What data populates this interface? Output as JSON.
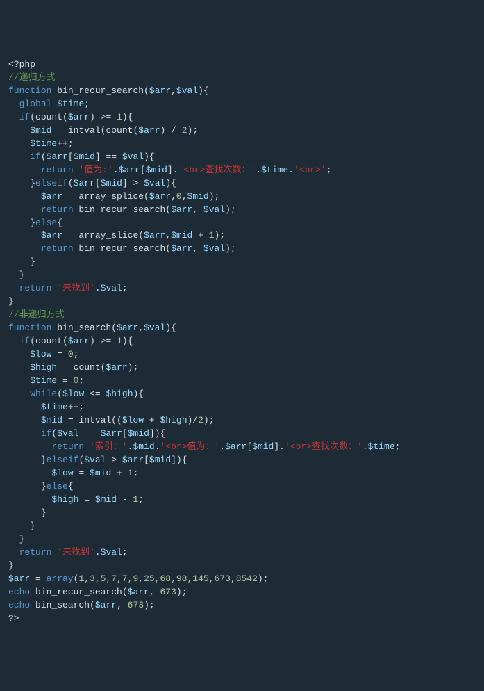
{
  "code": {
    "l1_tag_open": "<?php",
    "l2_cmt": "//递归方式",
    "l3_kw_function": "function",
    "l3_fn": " bin_recur_search(",
    "l3_vA": "$arr",
    "l3_c1": ",",
    "l3_vB": "$val",
    "l3_c2": "){",
    "l4_kw": "global",
    "l4_sp": " ",
    "l4_v": "$time",
    "l4_e": ";",
    "l5_kw": "if",
    "l5_o": "(count(",
    "l5_v": "$arr",
    "l5_c": ") >= ",
    "l5_n": "1",
    "l5_e": "){",
    "l6_v1": "$mid",
    "l6_eq": " = intval(count(",
    "l6_v2": "$arr",
    "l6_c": ") / ",
    "l6_n": "2",
    "l6_e": ");",
    "l7_v": "$time",
    "l7_e": "++;",
    "l8_kw": "if",
    "l8_o": "(",
    "l8_v1": "$arr",
    "l8_m1": "[",
    "l8_v2": "$mid",
    "l8_m2": "] == ",
    "l8_v3": "$val",
    "l8_e": "){",
    "l9_kw": "return",
    "l9_sp": " ",
    "l9_s1": "'值为:'",
    "l9_d1": ".",
    "l9_v1": "$arr",
    "l9_b1": "[",
    "l9_v2": "$mid",
    "l9_b2": "].",
    "l9_s2": "'<br>查找次数：'",
    "l9_d2": ".",
    "l9_v3": "$time",
    "l9_d3": ".",
    "l9_s3": "'<br>'",
    "l9_e": ";",
    "l10_c": "}",
    "l10_kw": "elseif",
    "l10_o": "(",
    "l10_v1": "$arr",
    "l10_b1": "[",
    "l10_v2": "$mid",
    "l10_b2": "] > ",
    "l10_v3": "$val",
    "l10_e": "){",
    "l11_v1": "$arr",
    "l11_eq": " = array_splice(",
    "l11_v2": "$arr",
    "l11_c1": ",",
    "l11_n1": "0",
    "l11_c2": ",",
    "l11_v3": "$mid",
    "l11_e": ");",
    "l12_kw": "return",
    "l12_sp": " bin_recur_search(",
    "l12_v1": "$arr",
    "l12_c": ", ",
    "l12_v2": "$val",
    "l12_e": ");",
    "l13_c": "}",
    "l13_kw": "else",
    "l13_e": "{",
    "l14_v1": "$arr",
    "l14_eq": " = array_slice(",
    "l14_v2": "$arr",
    "l14_c": ",",
    "l14_v3": "$mid",
    "l14_p": " + ",
    "l14_n": "1",
    "l14_e": ");",
    "l15_kw": "return",
    "l15_sp": " bin_recur_search(",
    "l15_v1": "$arr",
    "l15_c": ", ",
    "l15_v2": "$val",
    "l15_e": ");",
    "l16": "}",
    "l17": "}",
    "l18_kw": "return",
    "l18_sp": " ",
    "l18_s": "'未找到'",
    "l18_d": ".",
    "l18_v": "$val",
    "l18_e": ";",
    "l19": "}",
    "l20_cmt": "//非递归方式",
    "l21_kw": "function",
    "l21_fn": " bin_search(",
    "l21_v1": "$arr",
    "l21_c": ",",
    "l21_v2": "$val",
    "l21_e": "){",
    "l22_kw": "if",
    "l22_o": "(count(",
    "l22_v": "$arr",
    "l22_c": ") >= ",
    "l22_n": "1",
    "l22_e": "){",
    "l23_v": "$low",
    "l23_eq": " = ",
    "l23_n": "0",
    "l23_e": ";",
    "l24_v": "$high",
    "l24_eq": " = count(",
    "l24_v2": "$arr",
    "l24_e": ");",
    "l25_v": "$time",
    "l25_eq": " = ",
    "l25_n": "0",
    "l25_e": ";",
    "l26_kw": "while",
    "l26_o": "(",
    "l26_v1": "$low",
    "l26_c": " <= ",
    "l26_v2": "$high",
    "l26_e": "){",
    "l27_v": "$time",
    "l27_e": "++;",
    "l28_v1": "$mid",
    "l28_eq": " = intval((",
    "l28_v2": "$low",
    "l28_p": " + ",
    "l28_v3": "$high",
    "l28_c": ")/",
    "l28_n": "2",
    "l28_e": ");",
    "l29_kw": "if",
    "l29_o": "(",
    "l29_v1": "$val",
    "l29_c": " == ",
    "l29_v2": "$arr",
    "l29_b1": "[",
    "l29_v3": "$mid",
    "l29_b2": "]){",
    "l30_kw": "return",
    "l30_sp": " ",
    "l30_s1": "'索引：'",
    "l30_d1": ".",
    "l30_v1": "$mid",
    "l30_d2": ".",
    "l30_s2": "'<br>值为：'",
    "l30_d3": ".",
    "l30_v2": "$arr",
    "l30_b1": "[",
    "l30_v3": "$mid",
    "l30_b2": "].",
    "l30_s3": "'<br>查找次数：'",
    "l30_d4": ".",
    "l30_v4": "$time",
    "l30_e": ";",
    "l31_c": "}",
    "l31_kw": "elseif",
    "l31_o": "(",
    "l31_v1": "$val",
    "l31_cmp": " > ",
    "l31_v2": "$arr",
    "l31_b1": "[",
    "l31_v3": "$mid",
    "l31_b2": "]){",
    "l32_v1": "$low",
    "l32_eq": " = ",
    "l32_v2": "$mid",
    "l32_p": " + ",
    "l32_n": "1",
    "l32_e": ";",
    "l33_c": "}",
    "l33_kw": "else",
    "l33_e": "{",
    "l34_v1": "$high",
    "l34_eq": " = ",
    "l34_v2": "$mid",
    "l34_p": " - ",
    "l34_n": "1",
    "l34_e": ";",
    "l35": "}",
    "l36": "}",
    "l37": "}",
    "l38_kw": "return",
    "l38_sp": " ",
    "l38_s": "'未找到'",
    "l38_d": ".",
    "l38_v": "$val",
    "l38_e": ";",
    "l39": "}",
    "l40_v": "$arr",
    "l40_eq": " = ",
    "l40_kw": "array",
    "l40_o": "(",
    "l40_vals": "1,3,5,7,7,9,25,68,98,145,673,8542",
    "l40_e": ");",
    "l41_kw": "echo",
    "l41_sp": " bin_recur_search(",
    "l41_v1": "$arr",
    "l41_c": ", ",
    "l41_n": "673",
    "l41_e": ");",
    "l42_kw": "echo",
    "l42_sp": " bin_search(",
    "l42_v1": "$arr",
    "l42_c": ", ",
    "l42_n": "673",
    "l42_e": ");",
    "l43": "?>"
  }
}
